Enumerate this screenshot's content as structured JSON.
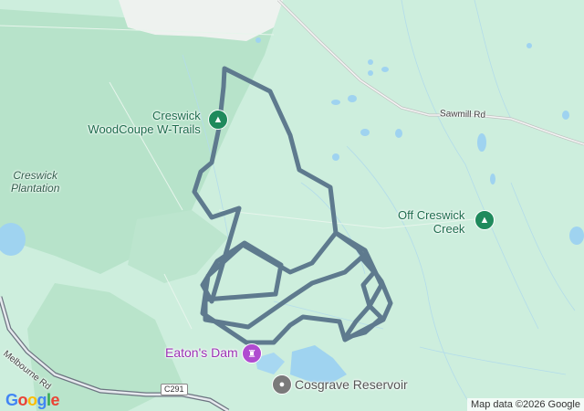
{
  "map": {
    "colors": {
      "land": "#cdeedd",
      "forest": "#b5e2c8",
      "water": "#9fd3f0",
      "route": "#5e7a8e"
    },
    "places": {
      "woodcoupe": {
        "line1": "Creswick",
        "line2": "WoodCoupe W-Trails",
        "icon": "tree-icon"
      },
      "plantation": {
        "line1": "Creswick",
        "line2": "Plantation"
      },
      "off_creek": {
        "line1": "Off Creswick",
        "line2": "Creek",
        "icon": "tree-icon"
      },
      "eatons_dam": {
        "label": "Eaton's Dam",
        "icon": "castle-icon"
      },
      "cosgrave": {
        "label": "Cosgrave Reservoir",
        "icon": "circle-icon"
      }
    },
    "roads": {
      "sawmill": "Sawmill Rd",
      "melbourne": "Melbourne Rd",
      "shield": "C291"
    },
    "logo": "Google",
    "attribution": "Map data ©2026 Google"
  }
}
